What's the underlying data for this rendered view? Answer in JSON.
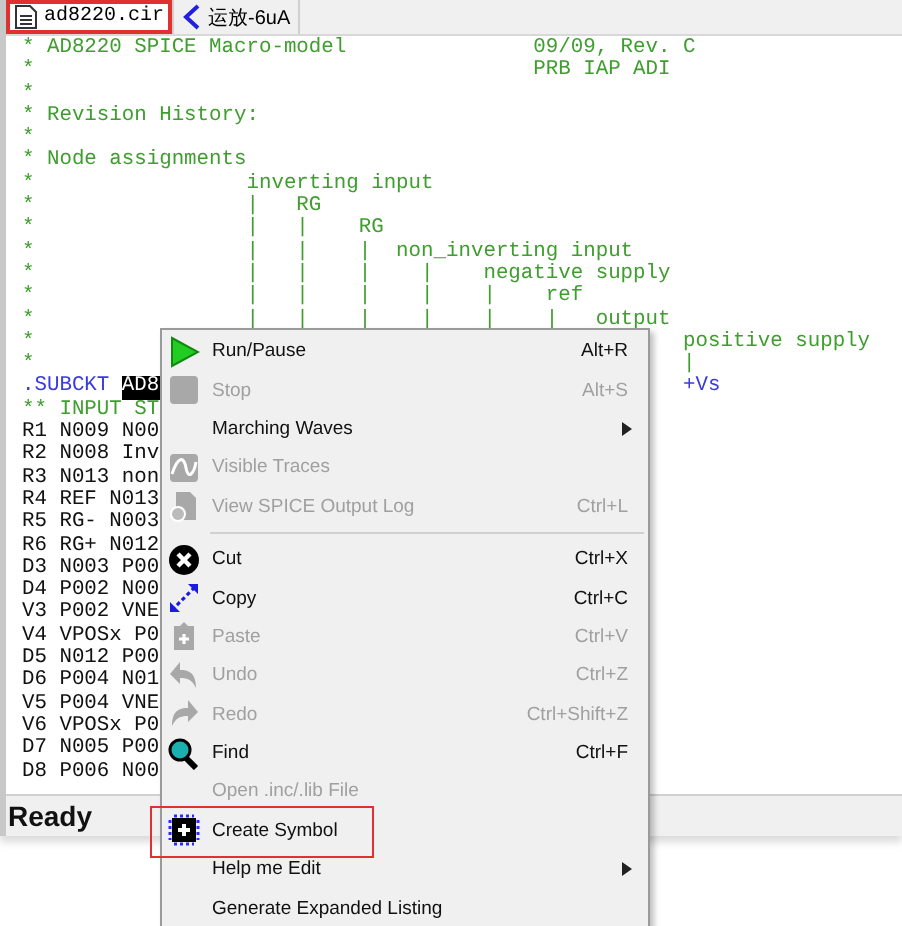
{
  "tabs": [
    {
      "label": "ad8220.cir",
      "kind": "document",
      "selected": true,
      "highlighted": true
    },
    {
      "label": "运放-6uA",
      "kind": "schematic",
      "selected": false,
      "highlighted": false
    }
  ],
  "editor": {
    "lines": [
      [
        {
          "text": "* AD8220 SPICE Macro-model               09/09, Rev. C",
          "kind": "comment"
        }
      ],
      [
        {
          "text": "*                                        PRB IAP ADI",
          "kind": "comment"
        }
      ],
      [
        {
          "text": "*",
          "kind": "comment"
        }
      ],
      [
        {
          "text": "* Revision History:",
          "kind": "comment"
        }
      ],
      [
        {
          "text": "*",
          "kind": "comment"
        }
      ],
      [
        {
          "text": "* Node assignments",
          "kind": "comment"
        }
      ],
      [
        {
          "text": "*                 inverting input",
          "kind": "comment"
        }
      ],
      [
        {
          "text": "*                 |   RG",
          "kind": "comment"
        }
      ],
      [
        {
          "text": "*                 |   |    RG",
          "kind": "comment"
        }
      ],
      [
        {
          "text": "*                 |   |    |  non_inverting input",
          "kind": "comment"
        }
      ],
      [
        {
          "text": "*                 |   |    |    |    negative supply",
          "kind": "comment"
        }
      ],
      [
        {
          "text": "*                 |   |    |    |    |    ref",
          "kind": "comment"
        }
      ],
      [
        {
          "text": "*                 |   |    |    |    |    |   output",
          "kind": "comment"
        }
      ],
      [
        {
          "text": "*",
          "kind": "comment"
        },
        {
          "text": "                                                    positive supply",
          "kind": "comment"
        }
      ],
      [
        {
          "text": "*",
          "kind": "comment"
        },
        {
          "text": "                                                    |",
          "kind": "comment"
        }
      ],
      [
        {
          "text": ".SUBCKT",
          "kind": "keyword"
        },
        {
          "text": " AD8",
          "kind": "selected"
        },
        {
          "text": "                                          +Vs",
          "kind": "keyword"
        }
      ],
      [
        {
          "text": "** INPUT ST",
          "kind": "comment"
        }
      ],
      [
        {
          "text": "R1 N009 N00",
          "kind": "code"
        }
      ],
      [
        {
          "text": "R2 N008 Inv",
          "kind": "code"
        }
      ],
      [
        {
          "text": "R3 N013 non",
          "kind": "code"
        }
      ],
      [
        {
          "text": "R4 REF N013",
          "kind": "code"
        }
      ],
      [
        {
          "text": "R5 RG- N003",
          "kind": "code"
        }
      ],
      [
        {
          "text": "R6 RG+ N012",
          "kind": "code"
        }
      ],
      [
        {
          "text": "D3 N003 P00",
          "kind": "code"
        }
      ],
      [
        {
          "text": "D4 P002 N00",
          "kind": "code"
        }
      ],
      [
        {
          "text": "V3 P002 VNE",
          "kind": "code"
        }
      ],
      [
        {
          "text": "V4 VPOSx P0",
          "kind": "code"
        }
      ],
      [
        {
          "text": "D5 N012 P00",
          "kind": "code"
        }
      ],
      [
        {
          "text": "D6 P004 N01",
          "kind": "code"
        }
      ],
      [
        {
          "text": "V5 P004 VNE",
          "kind": "code"
        }
      ],
      [
        {
          "text": "V6 VPOSx P0",
          "kind": "code"
        }
      ],
      [
        {
          "text": "D7 N005 P00",
          "kind": "code"
        }
      ],
      [
        {
          "text": "D8 P006 N00",
          "kind": "code"
        }
      ]
    ]
  },
  "status_bar": {
    "text": "Ready"
  },
  "context_menu": {
    "items": [
      {
        "kind": "run",
        "label": "Run/Pause",
        "shortcut": "Alt+R",
        "disabled": false,
        "submenu": false,
        "highlighted": false
      },
      {
        "kind": "stop",
        "label": "Stop",
        "shortcut": "Alt+S",
        "disabled": true,
        "submenu": false,
        "highlighted": false
      },
      {
        "kind": "plain",
        "label": "Marching Waves",
        "disabled": false,
        "submenu": true,
        "highlighted": false
      },
      {
        "kind": "traces",
        "label": "Visible Traces",
        "disabled": true,
        "submenu": false,
        "highlighted": false
      },
      {
        "kind": "log",
        "label": "View SPICE Output Log",
        "shortcut": "Ctrl+L",
        "disabled": true,
        "submenu": false,
        "highlighted": false
      },
      {
        "kind": "separator"
      },
      {
        "kind": "cut",
        "label": "Cut",
        "shortcut": "Ctrl+X",
        "disabled": false,
        "submenu": false,
        "highlighted": false
      },
      {
        "kind": "copy",
        "label": "Copy",
        "shortcut": "Ctrl+C",
        "disabled": false,
        "submenu": false,
        "highlighted": false
      },
      {
        "kind": "paste",
        "label": "Paste",
        "shortcut": "Ctrl+V",
        "disabled": true,
        "submenu": false,
        "highlighted": false
      },
      {
        "kind": "undo",
        "label": "Undo",
        "shortcut": "Ctrl+Z",
        "disabled": true,
        "submenu": false,
        "highlighted": false
      },
      {
        "kind": "redo",
        "label": "Redo",
        "shortcut": "Ctrl+Shift+Z",
        "disabled": true,
        "submenu": false,
        "highlighted": false
      },
      {
        "kind": "find",
        "label": "Find",
        "shortcut": "Ctrl+F",
        "disabled": false,
        "submenu": false,
        "highlighted": false
      },
      {
        "kind": "plain",
        "label": "Open .inc/.lib File",
        "disabled": true,
        "submenu": false,
        "highlighted": false
      },
      {
        "kind": "symbol",
        "label": "Create Symbol",
        "disabled": false,
        "submenu": false,
        "highlighted": true
      },
      {
        "kind": "plain",
        "label": "Help me Edit",
        "disabled": false,
        "submenu": true,
        "highlighted": false
      },
      {
        "kind": "plain",
        "label": "Generate Expanded Listing",
        "disabled": false,
        "submenu": false,
        "highlighted": false
      }
    ]
  }
}
